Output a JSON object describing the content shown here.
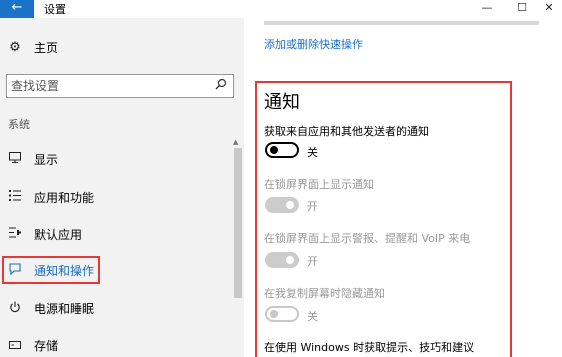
{
  "window": {
    "back_glyph": "←",
    "title": "设置",
    "minimize_glyph": "—",
    "maximize_glyph": "☐",
    "close_glyph": "✕"
  },
  "sidebar": {
    "home_label": "主页",
    "search_placeholder": "查找设置",
    "section_label": "系统",
    "items": [
      {
        "icon": "display-icon",
        "label": "显示"
      },
      {
        "icon": "apps-icon",
        "label": "应用和功能"
      },
      {
        "icon": "default-apps-icon",
        "label": "默认应用"
      },
      {
        "icon": "notification-icon",
        "label": "通知和操作",
        "active": true
      },
      {
        "icon": "power-icon",
        "label": "电源和睡眠"
      },
      {
        "icon": "storage-icon",
        "label": "存储"
      }
    ]
  },
  "main": {
    "quick_actions_link": "添加或删除快速操作",
    "notifications_heading": "通知",
    "settings": [
      {
        "label": "获取来自应用和其他发送者的通知",
        "state": "关",
        "enabled": true,
        "on": false
      },
      {
        "label": "在锁屏界面上显示通知",
        "state": "开",
        "enabled": false,
        "on": true
      },
      {
        "label": "在锁屏界面上显示警报、提醒和 VoIP 来电",
        "state": "开",
        "enabled": false,
        "on": true
      },
      {
        "label": "在我复制屏幕时隐藏通知",
        "state": "关",
        "enabled": false,
        "on": false
      },
      {
        "label": "在使用 Windows 时获取提示、技巧和建议"
      }
    ]
  },
  "colors": {
    "accent": "#1a73c7",
    "highlight_frame": "#e53935",
    "link": "#1a6fc4",
    "disabled_text": "#9a9a9a"
  }
}
